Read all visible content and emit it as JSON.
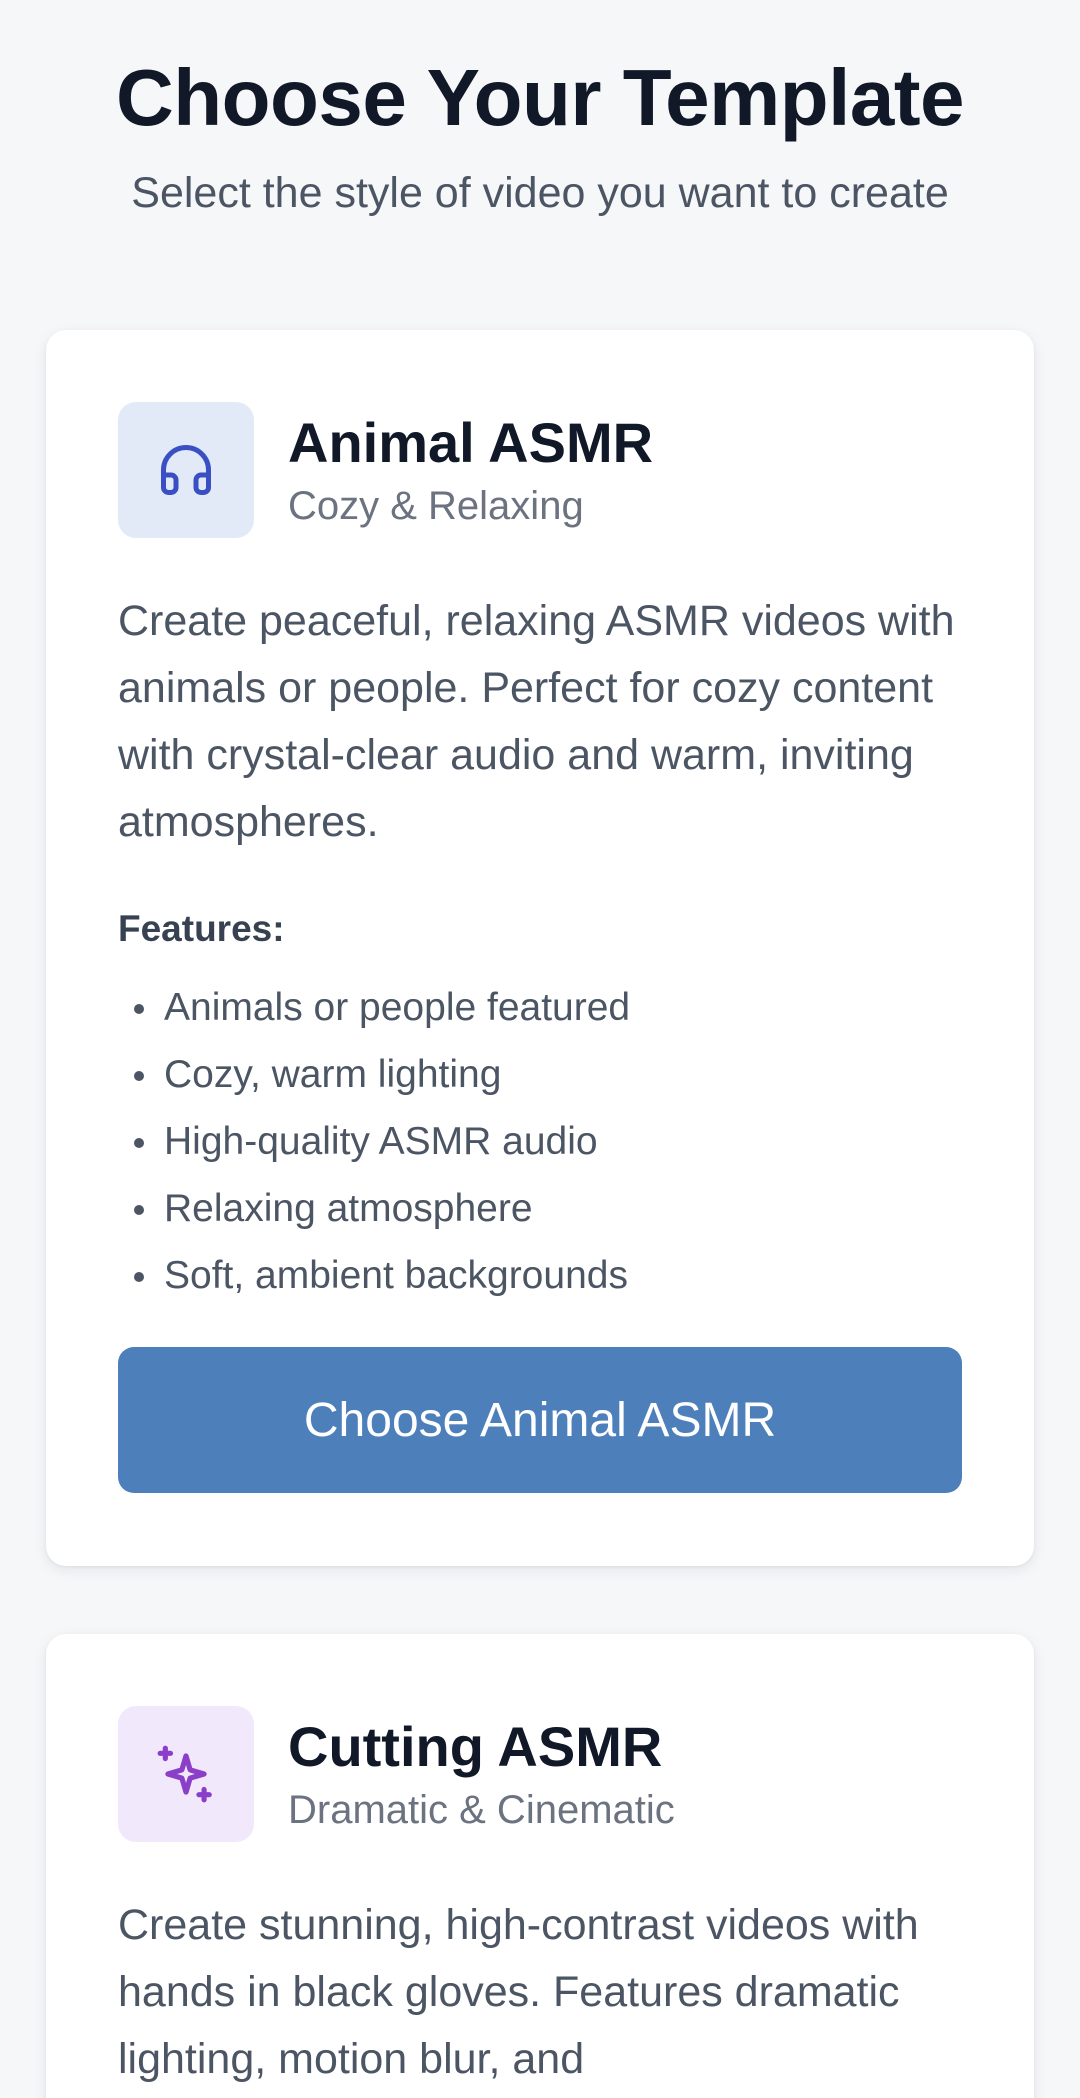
{
  "header": {
    "title": "Choose Your Template",
    "subtitle": "Select the style of video you want to create"
  },
  "templates": [
    {
      "icon": "headphones-icon",
      "icon_color": "#3b4fc4",
      "icon_bg": "#e2eaf7",
      "title": "Animal ASMR",
      "tagline": "Cozy & Relaxing",
      "description": "Create peaceful, relaxing ASMR videos with animals or people. Perfect for cozy content with crystal-clear audio and warm, inviting atmospheres.",
      "features_label": "Features:",
      "features": [
        "Animals or people featured",
        "Cozy, warm lighting",
        "High-quality ASMR audio",
        "Relaxing atmosphere",
        "Soft, ambient backgrounds"
      ],
      "button_label": "Choose Animal ASMR",
      "button_color": "#4d80bb"
    },
    {
      "icon": "sparkles-icon",
      "icon_color": "#8b3fc9",
      "icon_bg": "#f1e8fb",
      "title": "Cutting ASMR",
      "tagline": "Dramatic & Cinematic",
      "description": "Create stunning, high-contrast videos with hands in black gloves. Features dramatic lighting, motion blur, and"
    }
  ]
}
